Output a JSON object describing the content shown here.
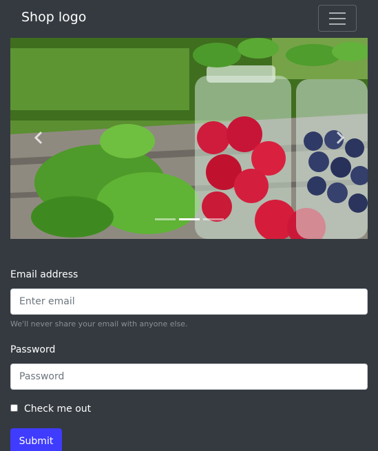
{
  "navbar": {
    "brand": "Shop logo",
    "toggler_icon": "hamburger-icon"
  },
  "carousel": {
    "image_alt": "",
    "prev_icon": "chevron-left-icon",
    "next_icon": "chevron-right-icon",
    "slide_count": 3,
    "active_slide": 2
  },
  "form": {
    "email_label": "Email address",
    "email_placeholder": "Enter email",
    "email_help": "We'll never share your email with anyone else.",
    "password_label": "Password",
    "password_placeholder": "Password",
    "check_label": "Check me out",
    "submit_label": "Submit"
  },
  "colors": {
    "background": "#343a40",
    "primary": "#3f3bff"
  }
}
